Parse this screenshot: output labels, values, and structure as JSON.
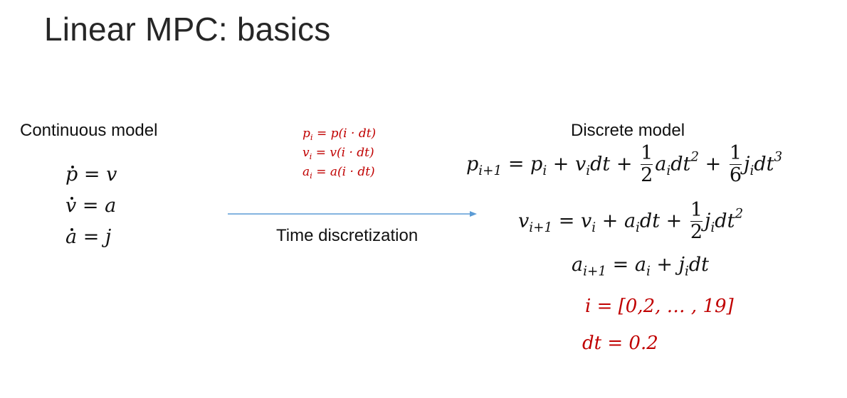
{
  "title": "Linear MPC: basics",
  "labels": {
    "continuous": "Continuous model",
    "discrete": "Discrete model",
    "time_discretization": "Time discretization"
  },
  "continuous_model": [
    "ṗ = v",
    "v̇ = a",
    "ȧ = j"
  ],
  "sampling_definitions": [
    "p_i = p(i · dt)",
    "v_i = v(i · dt)",
    "a_i = a(i · dt)"
  ],
  "discrete_model": [
    "p_{i+1} = p_i + v_i dt + 1/2 a_i dt^2 + 1/6 j_i dt^3",
    "v_{i+1} = v_i + a_i dt + 1/2 j_i dt^2",
    "a_{i+1} = a_i + j_i dt"
  ],
  "parameters": {
    "i": "i = [0,2, … , 19]",
    "dt": "dt = 0.2"
  },
  "colors": {
    "highlight": "#c00000",
    "arrow": "#5b9bd5",
    "text": "#111111"
  }
}
